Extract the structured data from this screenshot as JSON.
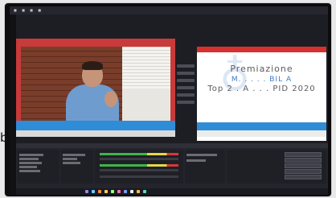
{
  "program": {
    "line1": "Premiazione",
    "line2": "M. . . . . BIL A",
    "line3": "Top 2 . A . . . PID 2020"
  },
  "side_text": "b",
  "colors": {
    "preview_border": "#c93a3a",
    "accent_blue": "#2f8cd7",
    "program_text": "#5b5a61"
  },
  "icons": [
    "bezel-frame",
    "person-webcam",
    "start-menu",
    "taskbar-apps"
  ]
}
